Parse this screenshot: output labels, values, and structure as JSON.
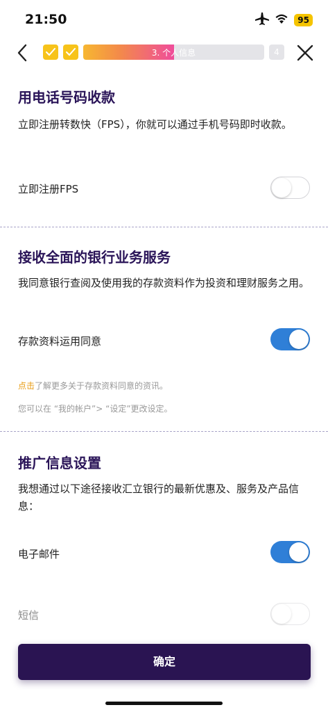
{
  "status_bar": {
    "time": "21:50",
    "battery": "95",
    "icons": [
      "airplane-icon",
      "wifi-icon"
    ]
  },
  "header": {
    "progress_label": "3. 个人信息",
    "progress_fraction": 0.5,
    "step_four": "4"
  },
  "fps_section": {
    "title": "用电话号码收款",
    "description": "立即注册转数快（FPS），你就可以通过手机号码即时收款。",
    "toggle_label": "立即注册FPS",
    "toggle_on": false
  },
  "banking_section": {
    "title": "接收全面的银行业务服务",
    "description": "我同意银行查阅及使用我的存款资料作为投资和理财服务之用。",
    "toggle_label": "存款资料运用同意",
    "toggle_on": true,
    "note_link": "点击",
    "note_text": "了解更多关于存款资料同意的资讯。",
    "settings_note": "您可以在 “我的帐户”> “设定”更改设定。"
  },
  "promo_section": {
    "title": "推广信息设置",
    "description": "我想通过以下途径接收汇立银行的最新优惠及、服务及产品信息：",
    "email_label": "电子邮件",
    "email_on": true,
    "sms_label": "短信",
    "sms_on": false
  },
  "footer": {
    "confirm_label": "确定"
  },
  "colors": {
    "primary": "#2a1452",
    "toggle_on": "#2f7fd7",
    "check": "#f7c31a",
    "link": "#e89b12"
  }
}
